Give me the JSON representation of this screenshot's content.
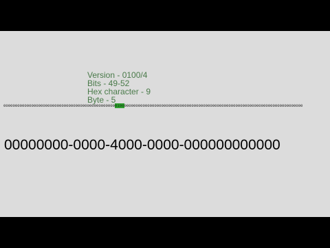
{
  "info": {
    "version": "Version - 0100/4",
    "bits": "Bits - 49-52",
    "hex_character": "Hex character - 9",
    "byte": "Byte - 5"
  },
  "bitstream": {
    "before": "000000000000000000000000000000000000000000000000",
    "highlight": "0100",
    "after": "00000000000000000000000000000000000000000000000000000000000000000000000000000"
  },
  "uuid": "00000000-0000-4000-0000-000000000000",
  "colors": {
    "background": "#dcdcdc",
    "info_text": "#4a7a4a",
    "highlight": "#2e9e2e",
    "letterbox": "#000000"
  }
}
